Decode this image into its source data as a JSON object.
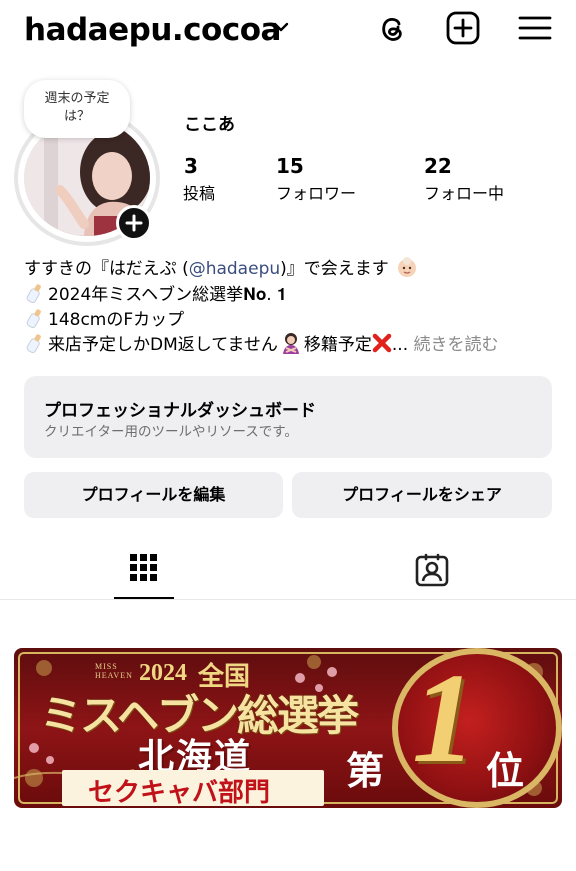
{
  "header": {
    "username": "hadaepu.cocoa",
    "icons": [
      "chevron-down-icon",
      "threads-icon",
      "create-post-icon",
      "menu-icon"
    ]
  },
  "profile": {
    "note": "週末の予定は？",
    "display_name": "ここあ",
    "stats": [
      {
        "value": "3",
        "label": "投稿"
      },
      {
        "value": "15",
        "label": "フォロワー"
      },
      {
        "value": "22",
        "label": "フォロー中"
      }
    ]
  },
  "bio": {
    "line1_prefix": "すすきの『はだえぷ (",
    "line1_mention": "@hadaepu",
    "line1_suffix": ")』で会えます",
    "line2": "2024年ミスヘブン総選挙𝐍𝐨. 𝟏",
    "line3": "148cmのFカップ",
    "line4_prefix": "来店予定しかDM返してません",
    "line4_mid": "移籍予定",
    "line4_ellipsis": "...",
    "more": "続きを読む"
  },
  "dashboard": {
    "title": "プロフェッショナルダッシュボード",
    "subtitle": "クリエイター用のツールやリソースです。"
  },
  "buttons": {
    "edit": "プロフィールを編集",
    "share": "プロフィールをシェア"
  },
  "tabs": [
    "grid-icon",
    "tagged-icon"
  ],
  "banner": {
    "miss_heaven": "MISS\nHEAVEN",
    "year": "2024",
    "zenkoku": "全国",
    "title": "ミスヘブン総選挙",
    "region": "北海道",
    "category": "セクキャバ部門",
    "dai": "第",
    "rank": "1",
    "i": "位"
  },
  "colors": {
    "mention": "#3a4d7c",
    "button_bg": "#efeff1",
    "banner_red": "#8e1416",
    "banner_gold": "#d9b765"
  }
}
